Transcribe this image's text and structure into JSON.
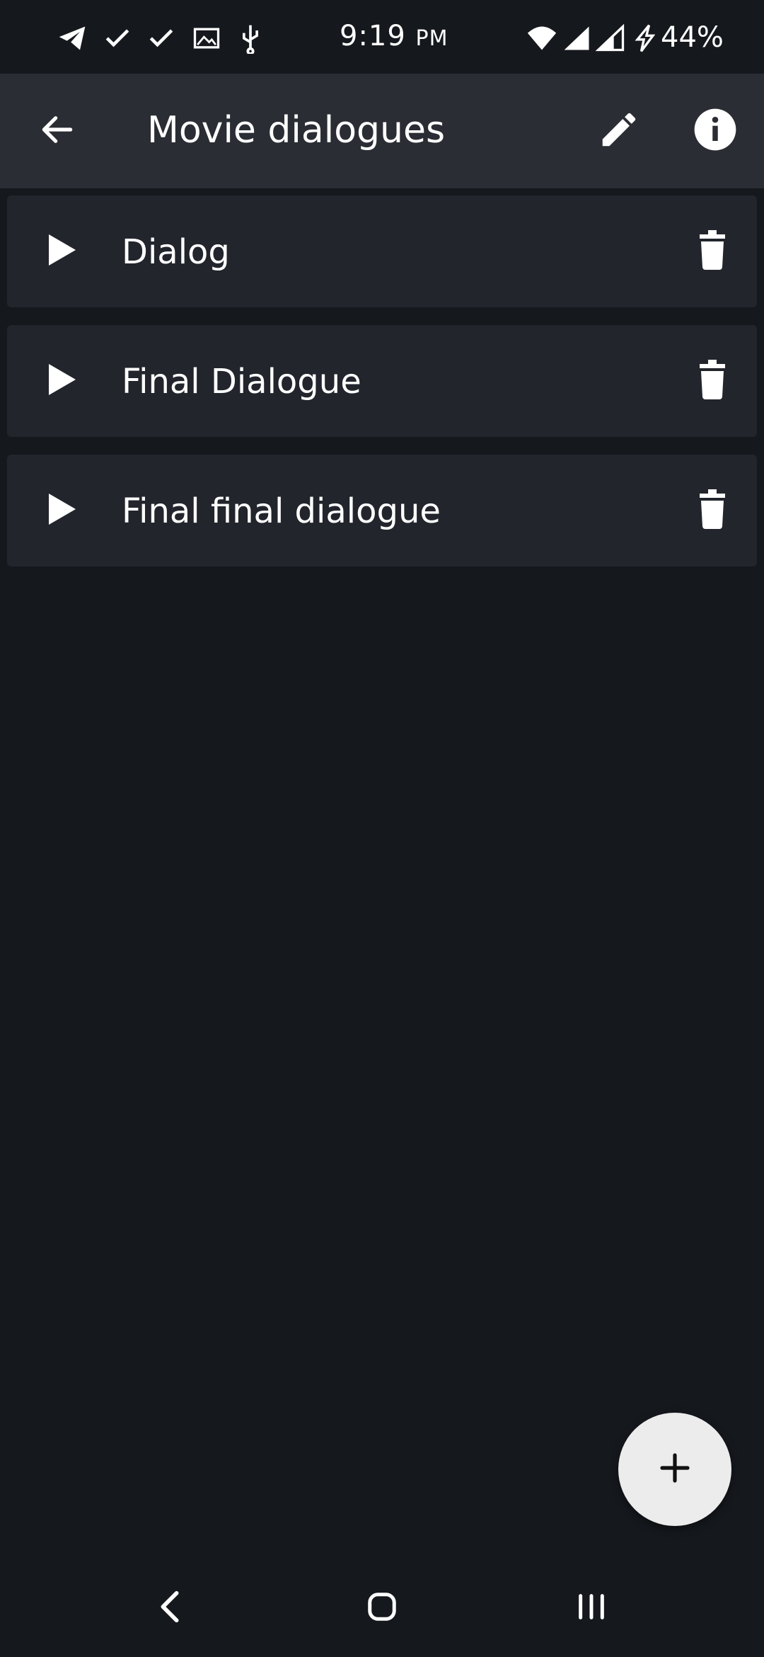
{
  "status_bar": {
    "time": "9:19",
    "ampm": "PM",
    "battery": "44%",
    "icons": [
      "telegram-icon",
      "check-icon",
      "check-icon",
      "image-icon",
      "usb-icon",
      "wifi-icon",
      "signal-icon",
      "signal-icon",
      "charging-icon"
    ]
  },
  "app_bar": {
    "title": "Movie dialogues",
    "back_icon": "arrow-back-icon",
    "edit_icon": "pencil-icon",
    "info_icon": "info-icon"
  },
  "dialogues": [
    {
      "label": "Dialog"
    },
    {
      "label": "Final Dialogue"
    },
    {
      "label": "Final final dialogue"
    }
  ],
  "fab": {
    "icon": "plus-icon"
  },
  "nav_bar": {
    "icons": [
      "nav-back-icon",
      "home-icon",
      "recents-icon"
    ]
  },
  "colors": {
    "background": "#15181d",
    "app_bar": "#2a2d33",
    "card": "#22252c",
    "fab": "#ececec",
    "text": "#ffffff"
  }
}
